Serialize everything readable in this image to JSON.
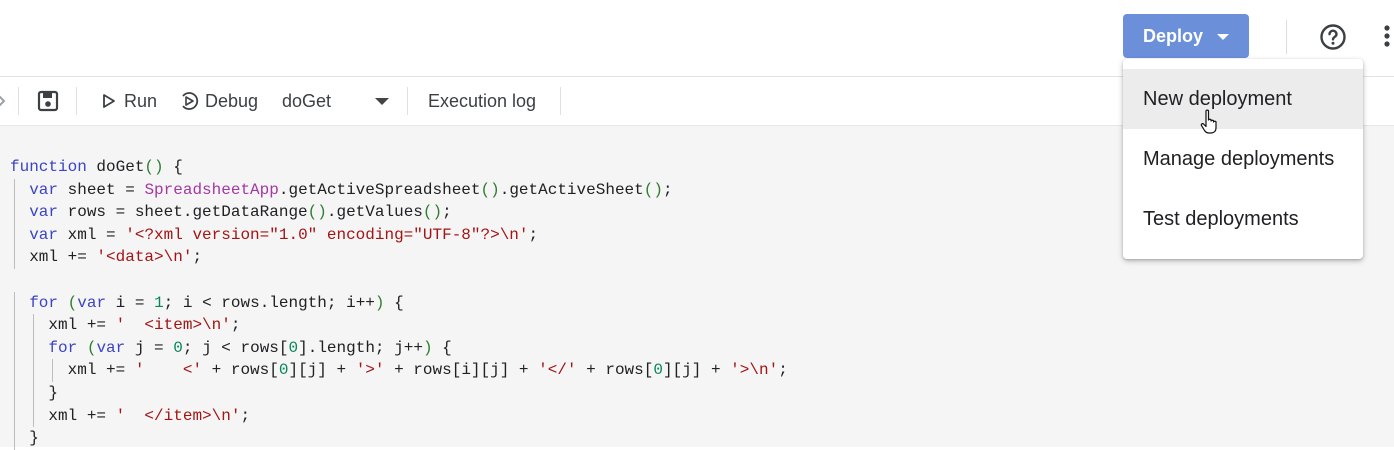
{
  "header": {
    "deploy_label": "Deploy"
  },
  "toolbar": {
    "run_label": "Run",
    "debug_label": "Debug",
    "function_select": "doGet",
    "execution_log_label": "Execution log"
  },
  "deploy_menu": {
    "items": [
      {
        "label": "New deployment"
      },
      {
        "label": "Manage deployments"
      },
      {
        "label": "Test deployments"
      }
    ]
  },
  "editor": {
    "language": "javascript",
    "lines": [
      "function doGet() {",
      "  var sheet = SpreadsheetApp.getActiveSpreadsheet().getActiveSheet();",
      "  var rows = sheet.getDataRange().getValues();",
      "  var xml = '<?xml version=\"1.0\" encoding=\"UTF-8\"?>\\n';",
      "  xml += '<data>\\n';",
      "",
      "  for (var i = 1; i < rows.length; i++) {",
      "    xml += '  <item>\\n';",
      "    for (var j = 0; j < rows[0].length; j++) {",
      "      xml += '    <' + rows[0][j] + '>' + rows[i][j] + '</' + rows[0][j] + '>\\n';",
      "    }",
      "    xml += '  </item>\\n';",
      "  }"
    ]
  },
  "colors": {
    "deploy_button": "#6b8fd9",
    "keyword": "#3b44c4",
    "class": "#a537a3",
    "string": "#a31515",
    "number": "#098658",
    "editor_background": "#f5f5f5"
  }
}
